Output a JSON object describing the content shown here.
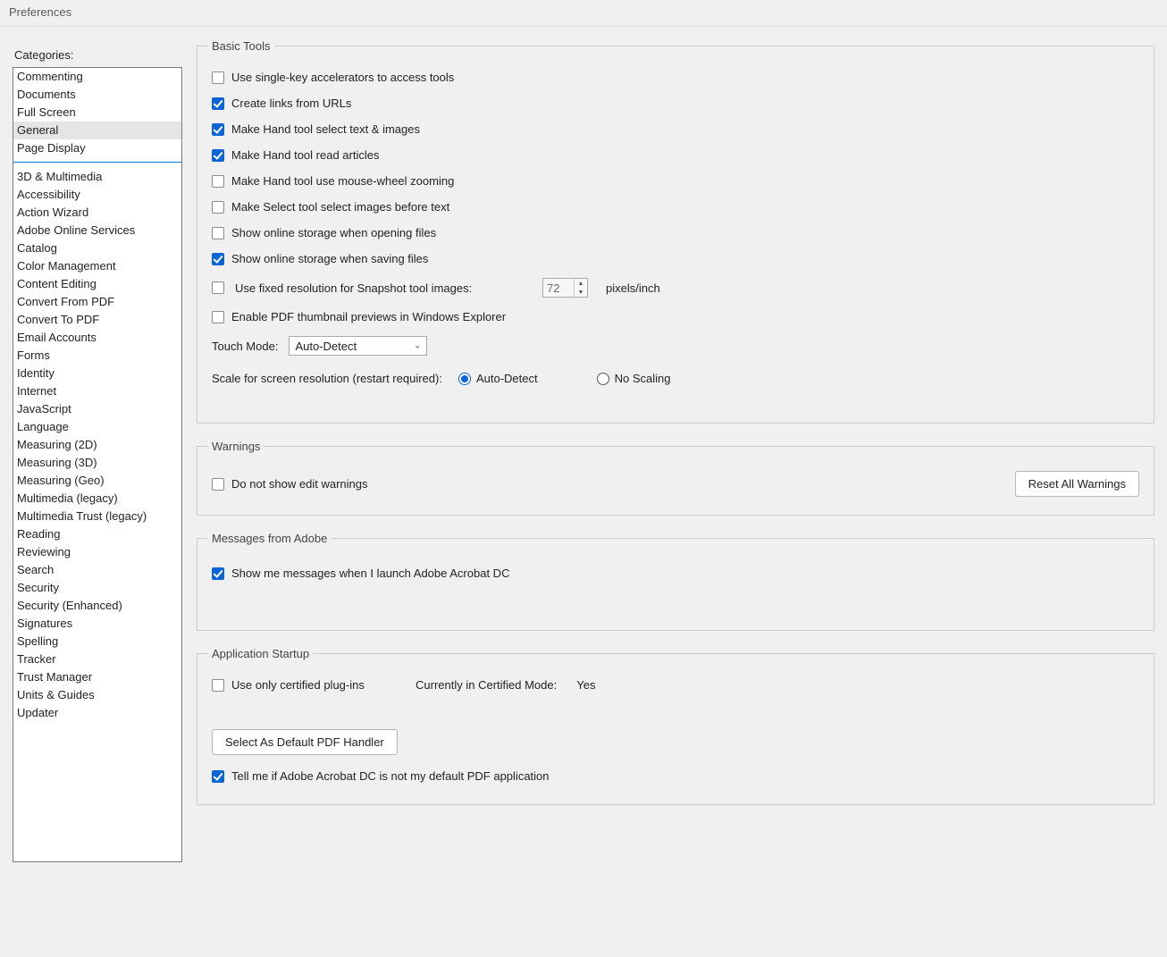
{
  "window": {
    "title": "Preferences"
  },
  "sidebar": {
    "label": "Categories:",
    "top_items": [
      "Commenting",
      "Documents",
      "Full Screen",
      "General",
      "Page Display"
    ],
    "selected": "General",
    "bottom_items": [
      "3D & Multimedia",
      "Accessibility",
      "Action Wizard",
      "Adobe Online Services",
      "Catalog",
      "Color Management",
      "Content Editing",
      "Convert From PDF",
      "Convert To PDF",
      "Email Accounts",
      "Forms",
      "Identity",
      "Internet",
      "JavaScript",
      "Language",
      "Measuring (2D)",
      "Measuring (3D)",
      "Measuring (Geo)",
      "Multimedia (legacy)",
      "Multimedia Trust (legacy)",
      "Reading",
      "Reviewing",
      "Search",
      "Security",
      "Security (Enhanced)",
      "Signatures",
      "Spelling",
      "Tracker",
      "Trust Manager",
      "Units & Guides",
      "Updater"
    ]
  },
  "groups": {
    "basic_tools": {
      "title": "Basic Tools",
      "opts": {
        "single_key": {
          "label": "Use single-key accelerators to access tools",
          "checked": false
        },
        "links_urls": {
          "label": "Create links from URLs",
          "checked": true
        },
        "hand_text": {
          "label": "Make Hand tool select text & images",
          "checked": true
        },
        "hand_read": {
          "label": "Make Hand tool read articles",
          "checked": true
        },
        "hand_wheel": {
          "label": "Make Hand tool use mouse-wheel zooming",
          "checked": false
        },
        "select_img": {
          "label": "Make Select tool select images before text",
          "checked": false
        },
        "storage_open": {
          "label": "Show online storage when opening files",
          "checked": false
        },
        "storage_save": {
          "label": "Show online storage when saving files",
          "checked": true
        },
        "fixed_res": {
          "label": "Use fixed resolution for Snapshot tool images:",
          "checked": false,
          "value": "72",
          "unit": "pixels/inch"
        },
        "thumb": {
          "label": "Enable PDF thumbnail previews in Windows Explorer",
          "checked": false
        }
      },
      "touch_mode": {
        "label": "Touch Mode:",
        "value": "Auto-Detect"
      },
      "scale": {
        "label": "Scale for screen resolution (restart required):",
        "auto": "Auto-Detect",
        "none": "No Scaling",
        "selected": "auto"
      }
    },
    "warnings": {
      "title": "Warnings",
      "edit_warn": {
        "label": "Do not show edit warnings",
        "checked": false
      },
      "reset_btn": "Reset All Warnings"
    },
    "messages": {
      "title": "Messages from Adobe",
      "launch_msg": {
        "label": "Show me messages when I launch Adobe Acrobat DC",
        "checked": true
      }
    },
    "startup": {
      "title": "Application Startup",
      "certified": {
        "label": "Use only certified plug-ins",
        "checked": false
      },
      "cert_mode_label": "Currently in Certified Mode:",
      "cert_mode_value": "Yes",
      "default_handler_btn": "Select As Default PDF Handler",
      "tell_default": {
        "label": "Tell me if Adobe Acrobat DC is not my default PDF application",
        "checked": true
      }
    }
  }
}
